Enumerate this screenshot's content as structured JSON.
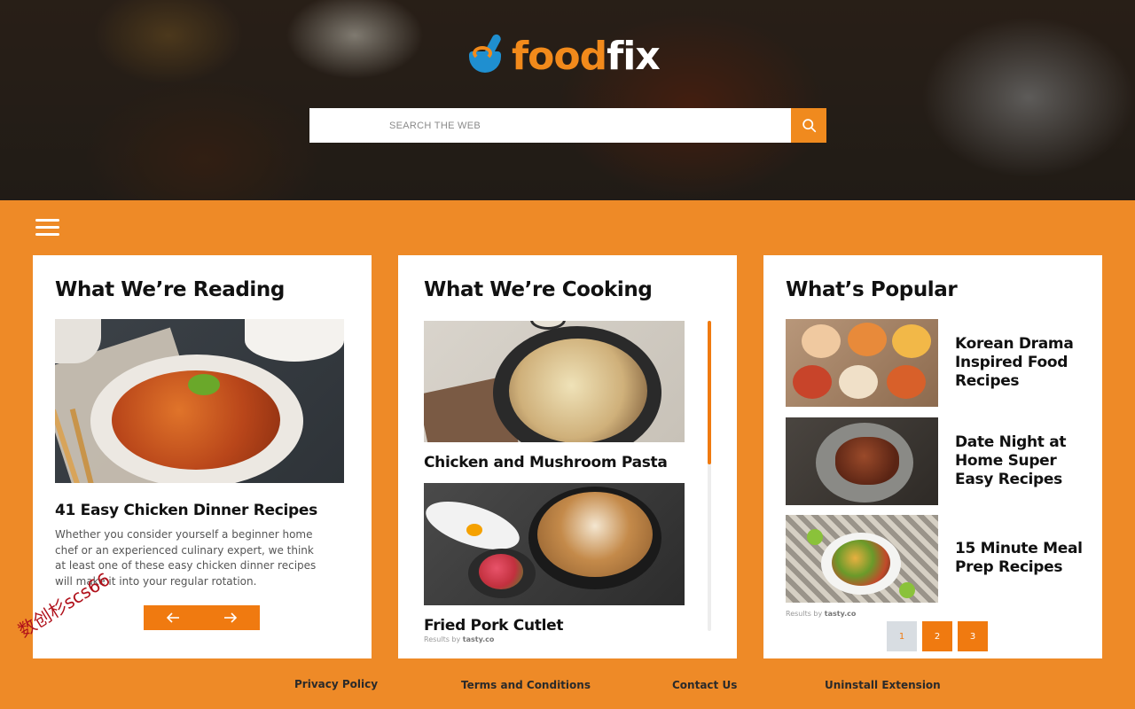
{
  "brand": {
    "name_part1": "food",
    "name_part2": "fix",
    "primary_color": "#ee8a27",
    "accent_color": "#f07a10",
    "logo_blue": "#1f8fd0"
  },
  "search": {
    "placeholder": "SEARCH THE WEB",
    "button_icon": "search-icon"
  },
  "menu": {
    "icon": "hamburger-menu-icon"
  },
  "reading": {
    "title": "What We’re Reading",
    "headline": "41 Easy Chicken Dinner Recipes",
    "body": "Whether you consider yourself a beginner home chef or an experienced culinary expert, we think at least one of these easy chicken dinner recipes will make it into your regular rotation.",
    "prev_icon": "arrow-left-icon",
    "next_icon": "arrow-right-icon"
  },
  "cooking": {
    "title": "What We’re Cooking",
    "items": [
      {
        "label": "Chicken and Mushroom Pasta"
      },
      {
        "label": "Fried Pork Cutlet"
      }
    ],
    "results_prefix": "Results by",
    "results_source": "tasty.co"
  },
  "popular": {
    "title": "What’s Popular",
    "items": [
      {
        "label": "Korean Drama Inspired Food Recipes"
      },
      {
        "label": "Date Night at Home Super Easy Recipes"
      },
      {
        "label": "15 Minute Meal Prep Recipes"
      }
    ],
    "results_prefix": "Results by",
    "results_source": "tasty.co",
    "pages": [
      "1",
      "2",
      "3"
    ],
    "current_page": "1"
  },
  "footer": {
    "links": [
      "Privacy Policy",
      "Terms and Conditions",
      "Contact Us",
      "Uninstall Extension"
    ]
  },
  "watermark": "数创杉scs66"
}
